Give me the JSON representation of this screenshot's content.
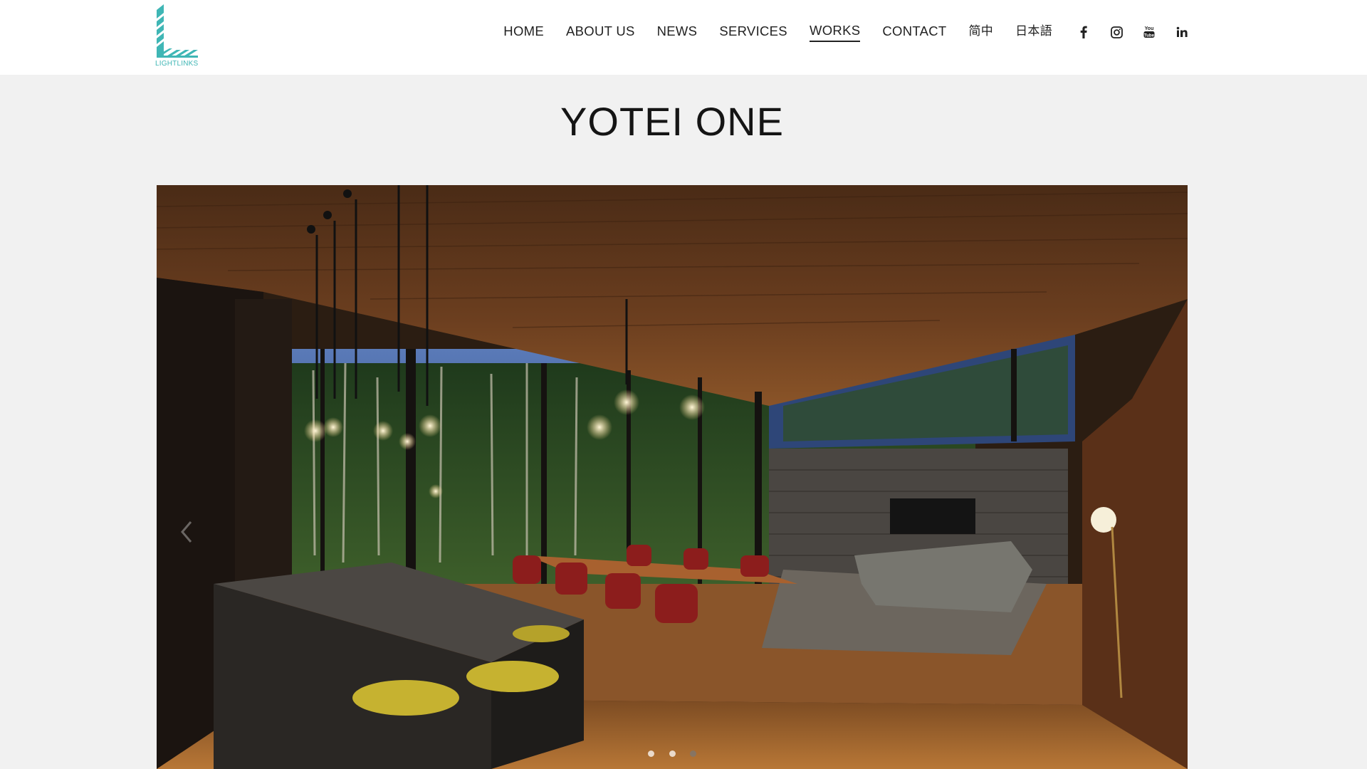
{
  "header": {
    "logo_text": "LIGHTLINKS",
    "nav": [
      {
        "label": "HOME",
        "name": "nav-home",
        "active": false
      },
      {
        "label": "ABOUT US",
        "name": "nav-about-us",
        "active": false
      },
      {
        "label": "NEWS",
        "name": "nav-news",
        "active": false
      },
      {
        "label": "SERVICES",
        "name": "nav-services",
        "active": false
      },
      {
        "label": "WORKS",
        "name": "nav-works",
        "active": true
      },
      {
        "label": "CONTACT",
        "name": "nav-contact",
        "active": false
      },
      {
        "label": "简中",
        "name": "nav-simplified-chinese",
        "active": false
      },
      {
        "label": "日本語",
        "name": "nav-japanese",
        "active": false
      }
    ],
    "social_icons": [
      "facebook-icon",
      "instagram-icon",
      "youtube-icon",
      "linkedin-icon"
    ],
    "youtube_icon_text": "You Tube",
    "linkedin_icon_text": "in"
  },
  "page": {
    "title": "YOTEI ONE"
  },
  "slider": {
    "prev_icon": "chevron-left-icon",
    "dots": [
      {
        "state": "visited"
      },
      {
        "state": "active"
      },
      {
        "state": "inactive"
      }
    ]
  },
  "colors": {
    "brand_teal": "#3fb6b5",
    "background": "#f1f1f1",
    "header_bg": "#ffffff",
    "text": "#222222"
  }
}
